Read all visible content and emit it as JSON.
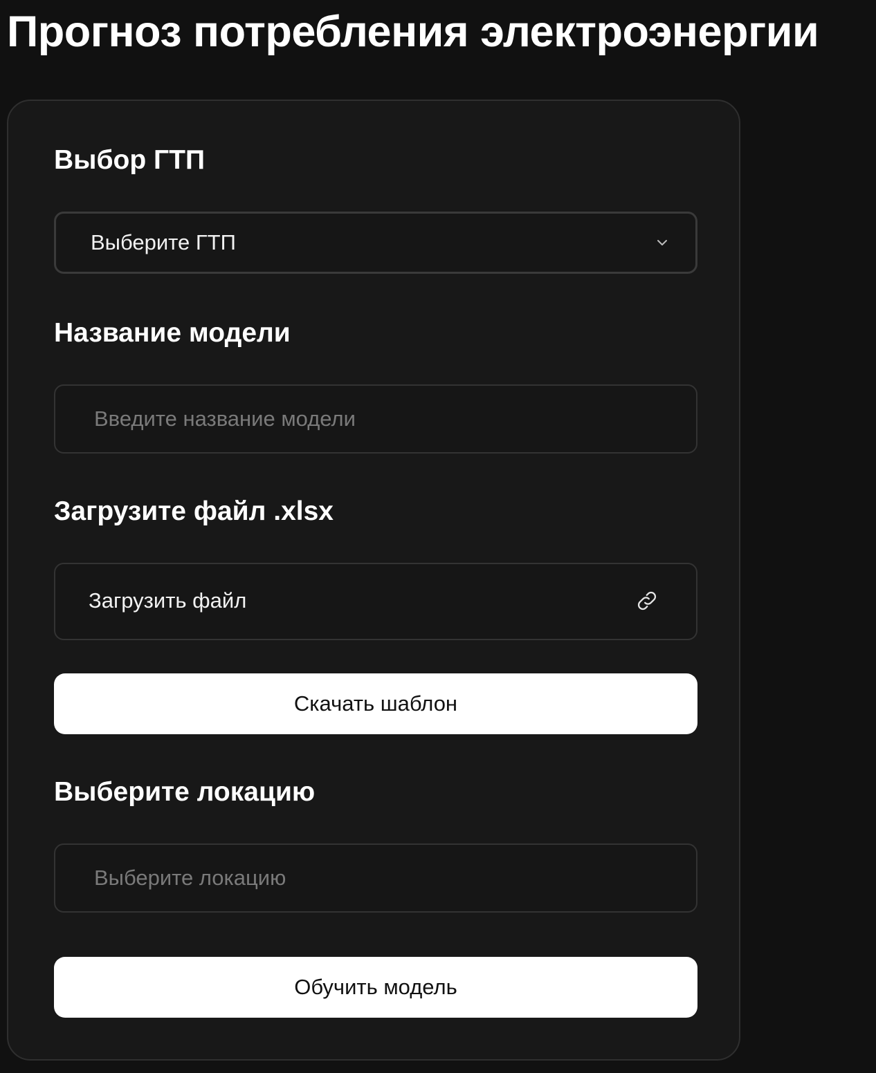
{
  "page": {
    "title": "Прогноз потребления электроэнергии"
  },
  "form": {
    "gtp": {
      "label": "Выбор ГТП",
      "selected": "Выберите ГТП",
      "icon": "chevron-down-icon"
    },
    "model_name": {
      "label": "Название модели",
      "value": "",
      "placeholder": "Введите название модели"
    },
    "file": {
      "label": "Загрузите файл .xlsx",
      "upload_label": "Загрузить файл",
      "icon": "link-icon"
    },
    "download_template_label": "Скачать шаблон",
    "location": {
      "label": "Выберите локацию",
      "value": "",
      "placeholder": "Выберите локацию"
    },
    "train_label": "Обучить модель"
  },
  "colors": {
    "background": "#111111",
    "card": "#181818",
    "border": "#333333",
    "button": "#ffffff",
    "button_text": "#111111",
    "placeholder": "#7a7a7a"
  }
}
